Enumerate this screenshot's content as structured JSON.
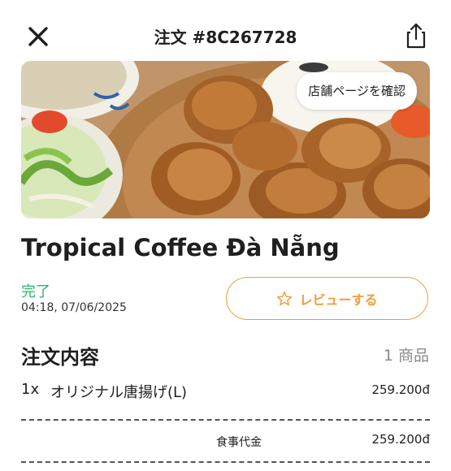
{
  "header": {
    "title": "注文 #8C267728",
    "close_icon": "close-icon",
    "share_icon": "share-icon"
  },
  "banner": {
    "store_page_label": "店舗ページを確認"
  },
  "store": {
    "name": "Tropical Coffee Đà Nẵng"
  },
  "order_status": {
    "status": "完了",
    "timestamp": "04:18, 07/06/2025"
  },
  "review": {
    "label": "レビューする",
    "icon": "star-outline-icon"
  },
  "order_details": {
    "title": "注文内容",
    "item_count": "1 商品",
    "items": [
      {
        "qty": "1x",
        "name": "オリジナル唐揚げ(L)",
        "price": "259.200đ"
      }
    ]
  },
  "summary": {
    "food_cost_label": "食事代金",
    "food_cost_value": "259.200đ"
  },
  "colors": {
    "accent": "#f39c3c",
    "status_green": "#2fb36b",
    "muted": "#8a8a8a"
  }
}
